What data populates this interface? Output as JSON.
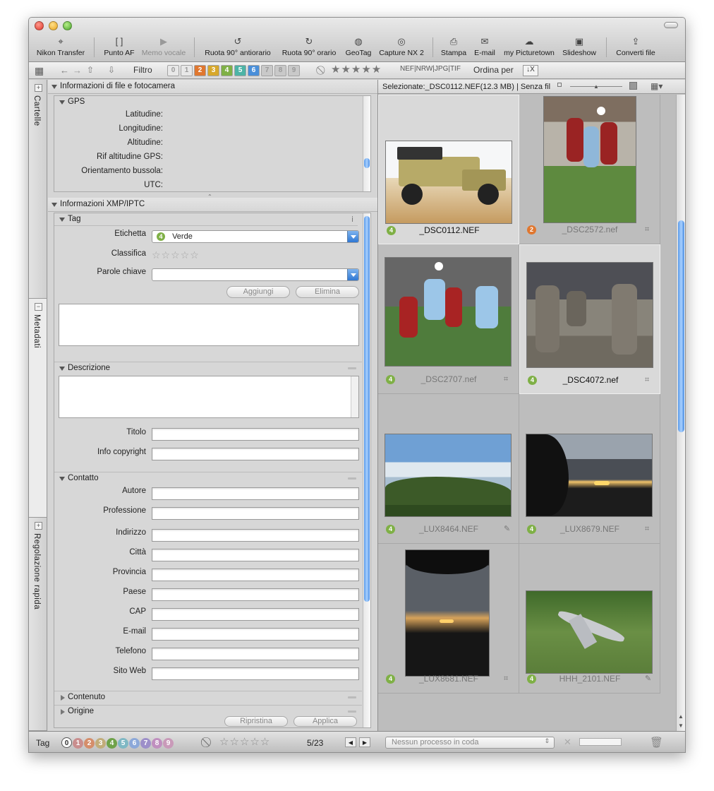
{
  "toolbar": {
    "items": [
      {
        "label": "Nikon Transfer",
        "icon": "camera-transfer-icon",
        "glyph": "⌖"
      },
      {
        "label": "Punto AF",
        "icon": "af-point-icon",
        "glyph": "[ ]"
      },
      {
        "label": "Memo vocale",
        "icon": "voice-memo-icon",
        "glyph": "▶"
      },
      {
        "label": "Ruota 90° antiorario",
        "icon": "rotate-ccw-icon",
        "glyph": "↺"
      },
      {
        "label": "Ruota 90° orario",
        "icon": "rotate-cw-icon",
        "glyph": "↻"
      },
      {
        "label": "GeoTag",
        "icon": "globe-icon",
        "glyph": "◍"
      },
      {
        "label": "Capture NX 2",
        "icon": "capture-nx-icon",
        "glyph": "◎"
      },
      {
        "label": "Stampa",
        "icon": "print-icon",
        "glyph": "⎙"
      },
      {
        "label": "E-mail",
        "icon": "email-icon",
        "glyph": "✉"
      },
      {
        "label": "my Picturetown",
        "icon": "picturetown-icon",
        "glyph": "☁"
      },
      {
        "label": "Slideshow",
        "icon": "slideshow-icon",
        "glyph": "▣"
      },
      {
        "label": "Converti file",
        "icon": "convert-file-icon",
        "glyph": "⇪"
      }
    ]
  },
  "filterbar": {
    "filter_label": "Filtro",
    "labels": [
      "0",
      "1",
      "2",
      "3",
      "4",
      "5",
      "6",
      "7",
      "8",
      "9"
    ],
    "label_colors": [
      "#e8e8e8",
      "#e8e8e8",
      "#e0772f",
      "#d7a82c",
      "#7fb046",
      "#4db3a6",
      "#4a8fd9",
      "#c9c9c9",
      "#c9c9c9",
      "#c9c9c9"
    ],
    "file_types": "NEF|NRW|JPG|TIF",
    "sort_label": "Ordina per"
  },
  "sidetabs": {
    "folders": "Cartelle",
    "metadata": "Metadati",
    "quick_adjust": "Regolazione rapida"
  },
  "file_info": {
    "title": "Informazioni di file e fotocamera",
    "gps_title": "GPS",
    "gps_fields": [
      "Latitudine:",
      "Longitudine:",
      "Altitudine:",
      "Rif altitudine GPS:",
      "Orientamento bussola:",
      "UTC:"
    ]
  },
  "xmp": {
    "title": "Informazioni XMP/IPTC",
    "tag_title": "Tag",
    "label_field": "Etichetta",
    "label_value": "Verde",
    "label_value_num": "4",
    "rating_field": "Classifica",
    "keywords_field": "Parole chiave",
    "add_button": "Aggiungi",
    "delete_button": "Elimina",
    "description_title": "Descrizione",
    "title_field": "Titolo",
    "copyright_field": "Info copyright",
    "contact_title": "Contatto",
    "contact_fields": [
      "Autore",
      "Professione",
      "Indirizzo",
      "Città",
      "Provincia",
      "Paese",
      "CAP",
      "E-mail",
      "Telefono",
      "Sito Web"
    ],
    "content_title": "Contenuto",
    "origin_title": "Origine",
    "reset_button": "Ripristina",
    "apply_button": "Applica"
  },
  "browser": {
    "header": "Selezionate:_DSC0112.NEF(12.3 MB) | Senza fil",
    "thumbs": [
      {
        "name": "_DSC0112.NEF",
        "label": "4",
        "color": "#7fb046",
        "selected": true,
        "scene": "jeep"
      },
      {
        "name": "_DSC2572.nef",
        "label": "2",
        "color": "#e0772f",
        "selected": false,
        "scene": "football1"
      },
      {
        "name": "_DSC2707.nef",
        "label": "4",
        "color": "#7fb046",
        "selected": false,
        "scene": "football2"
      },
      {
        "name": "_DSC4072.nef",
        "label": "4",
        "color": "#7fb046",
        "selected": true,
        "scene": "mud"
      },
      {
        "name": "_LUX8464.NEF",
        "label": "4",
        "color": "#7fb046",
        "selected": false,
        "scene": "lake"
      },
      {
        "name": "_LUX8679.NEF",
        "label": "4",
        "color": "#7fb046",
        "selected": false,
        "scene": "sunset"
      },
      {
        "name": "_LUX8681.NEF",
        "label": "4",
        "color": "#7fb046",
        "selected": false,
        "scene": "sunset2"
      },
      {
        "name": "HHH_2101.NEF",
        "label": "4",
        "color": "#7fb046",
        "selected": false,
        "scene": "jet"
      }
    ]
  },
  "status": {
    "tag_label": "Tag",
    "rings": [
      "0",
      "1",
      "2",
      "3",
      "4",
      "5",
      "6",
      "7",
      "8",
      "9"
    ],
    "ring_colors": [
      "#ffffff",
      "#c98e8e",
      "#d58e6b",
      "#c2ad7a",
      "#6fa24a",
      "#7fb8c4",
      "#8ca8d9",
      "#9d8fc9",
      "#c08fbf",
      "#c99ab9"
    ],
    "counter": "5/23",
    "queue": "Nessun processo in coda"
  }
}
